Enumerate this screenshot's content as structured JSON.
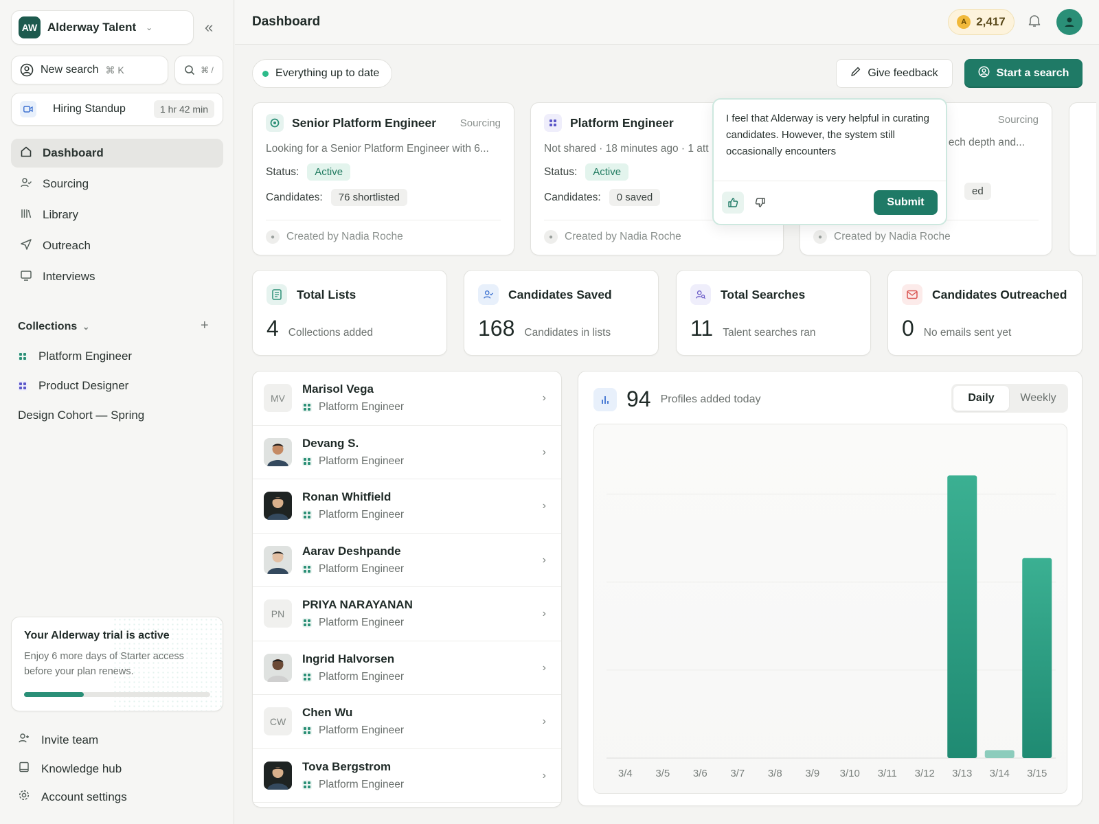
{
  "workspace": {
    "logo": "AW",
    "name": "Alderway Talent"
  },
  "sidebar": {
    "new_search": {
      "label": "New search",
      "shortcut": "⌘ K"
    },
    "quick_search_shortcut": "⌘ /",
    "meeting": {
      "title": "Hiring Standup",
      "time": "1 hr 42 min"
    },
    "nav": [
      {
        "label": "Dashboard",
        "icon": "home-icon"
      },
      {
        "label": "Sourcing",
        "icon": "people-icon"
      },
      {
        "label": "Library",
        "icon": "library-icon"
      },
      {
        "label": "Outreach",
        "icon": "send-icon"
      },
      {
        "label": "Interviews",
        "icon": "monitor-icon"
      }
    ],
    "collections_label": "Collections",
    "collections": [
      {
        "label": "Platform Engineer",
        "color": "#2b8f76"
      },
      {
        "label": "Product Designer",
        "color": "#5b57c8"
      },
      {
        "label": "Design Cohort — Spring"
      }
    ],
    "trial": {
      "title": "Your Alderway trial is active",
      "text": "Enjoy 6 more days of Starter access before your plan renews.",
      "progress": 0.32
    },
    "footer": [
      {
        "label": "Invite team",
        "icon": "add-user-icon"
      },
      {
        "label": "Knowledge hub",
        "icon": "book-icon"
      },
      {
        "label": "Account settings",
        "icon": "gear-icon"
      }
    ]
  },
  "header": {
    "title": "Dashboard",
    "credits": "2,417",
    "coin_letter": "A"
  },
  "toolbar": {
    "status": "Everything up to date",
    "feedback_label": "Give feedback",
    "start_label": "Start a search",
    "accent": "#1f7a66"
  },
  "search_cards": [
    {
      "title": "Senior Platform Engineer",
      "stage": "Sourcing",
      "desc": "Looking for a Senior Platform Engineer with 6...",
      "status_label": "Status:",
      "status": "Active",
      "candidates_label": "Candidates:",
      "candidates": "76 shortlisted",
      "created": "Created by Nadia Roche"
    },
    {
      "title": "Platform Engineer",
      "desc": "Not shared · 18 minutes ago · 1 att",
      "status_label": "Status:",
      "status": "Active",
      "candidates_label": "Candidates:",
      "candidates": "0 saved",
      "created": "Created by Nadia Roche"
    },
    {
      "stage": "Sourcing",
      "desc": "ech depth and...",
      "candidates": "ed",
      "created": "Created by Nadia Roche"
    }
  ],
  "feedback_popup": {
    "text": "I feel that Alderway is very helpful in curating candidates. However, the system still occasionally encounters",
    "submit": "Submit"
  },
  "stats": [
    {
      "title": "Total Lists",
      "value": "4",
      "sub": "Collections added",
      "icon": "list-icon",
      "color": "#2b8f76"
    },
    {
      "title": "Candidates Saved",
      "value": "168",
      "sub": "Candidates in lists",
      "icon": "user-check-icon",
      "color": "#3a6fd0"
    },
    {
      "title": "Total Searches",
      "value": "11",
      "sub": "Talent searches ran",
      "icon": "search-people-icon",
      "color": "#6b5bc8"
    },
    {
      "title": "Candidates Outreached",
      "value": "0",
      "sub": "No emails sent yet",
      "icon": "mail-icon",
      "color": "#d9534f"
    }
  ],
  "candidates": [
    {
      "name": "Marisol Vega",
      "initials": "MV",
      "role": "Platform Engineer",
      "photo": false
    },
    {
      "name": "Devang S.",
      "initials": "",
      "role": "Platform Engineer",
      "photo": true
    },
    {
      "name": "Ronan Whitfield",
      "initials": "",
      "role": "Platform Engineer",
      "photo": true
    },
    {
      "name": "Aarav Deshpande",
      "initials": "",
      "role": "Platform Engineer",
      "photo": true
    },
    {
      "name": "PRIYA NARAYANAN",
      "initials": "PN",
      "role": "Platform Engineer",
      "photo": false
    },
    {
      "name": "Ingrid Halvorsen",
      "initials": "",
      "role": "Platform Engineer",
      "photo": true
    },
    {
      "name": "Chen Wu",
      "initials": "CW",
      "role": "Platform Engineer",
      "photo": false
    },
    {
      "name": "Tova Bergstrom",
      "initials": "",
      "role": "Platform Engineer",
      "photo": true
    }
  ],
  "activity": {
    "value": "94",
    "label": "Profiles added today",
    "toggle": [
      "Daily",
      "Weekly"
    ],
    "active_toggle": "Daily"
  },
  "chart_data": {
    "type": "bar",
    "categories": [
      "3/4",
      "3/5",
      "3/6",
      "3/7",
      "3/8",
      "3/9",
      "3/10",
      "3/11",
      "3/12",
      "3/13",
      "3/14",
      "3/15"
    ],
    "values": [
      0,
      0,
      0,
      0,
      0,
      0,
      0,
      0,
      0,
      106,
      3,
      75
    ],
    "ylim": [
      0,
      120
    ],
    "grid": true,
    "bar_color": "#2a9c83"
  }
}
